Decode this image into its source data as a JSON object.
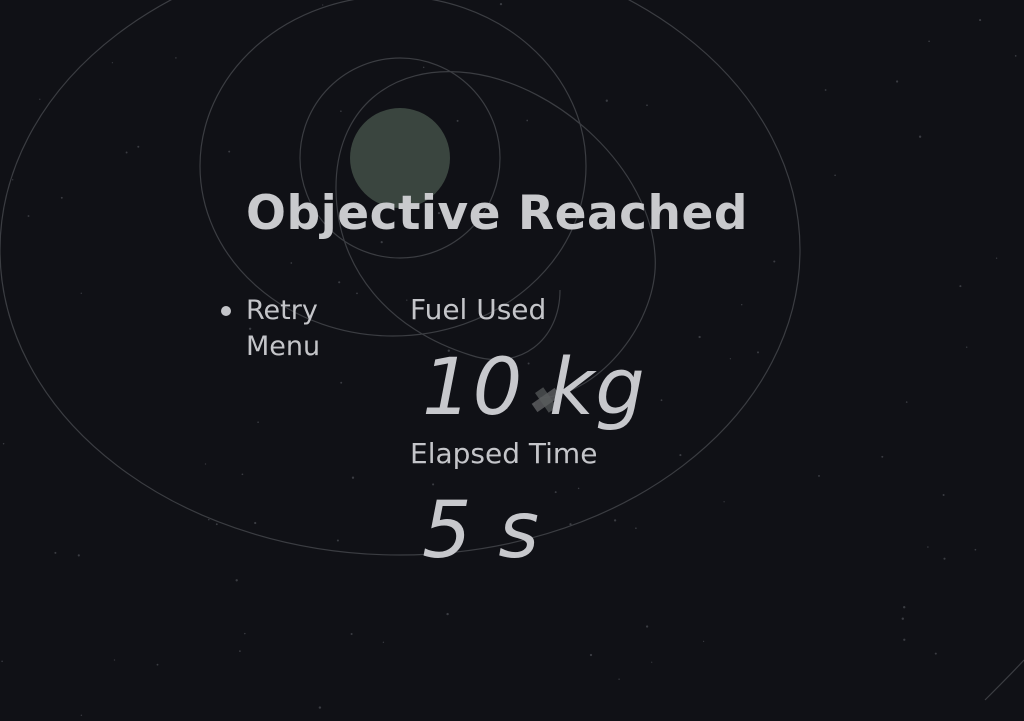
{
  "screen": {
    "title": "Objective Reached"
  },
  "menu": {
    "items": [
      {
        "label": "Retry",
        "selected": true
      },
      {
        "label": "Menu",
        "selected": false
      }
    ]
  },
  "stats": {
    "fuel_label": "Fuel Used",
    "fuel_value": "10 kg",
    "time_label": "Elapsed Time",
    "time_value": "5 s"
  },
  "scene": {
    "planet_color": "#3a453f",
    "orbit_color": "#3b3d42",
    "background_color": "#101116",
    "ship_color": "#5a5c5e"
  },
  "icons": {
    "menu_selector": "bullet-icon",
    "ship": "spacecraft-icon",
    "planet": "planet-icon"
  }
}
